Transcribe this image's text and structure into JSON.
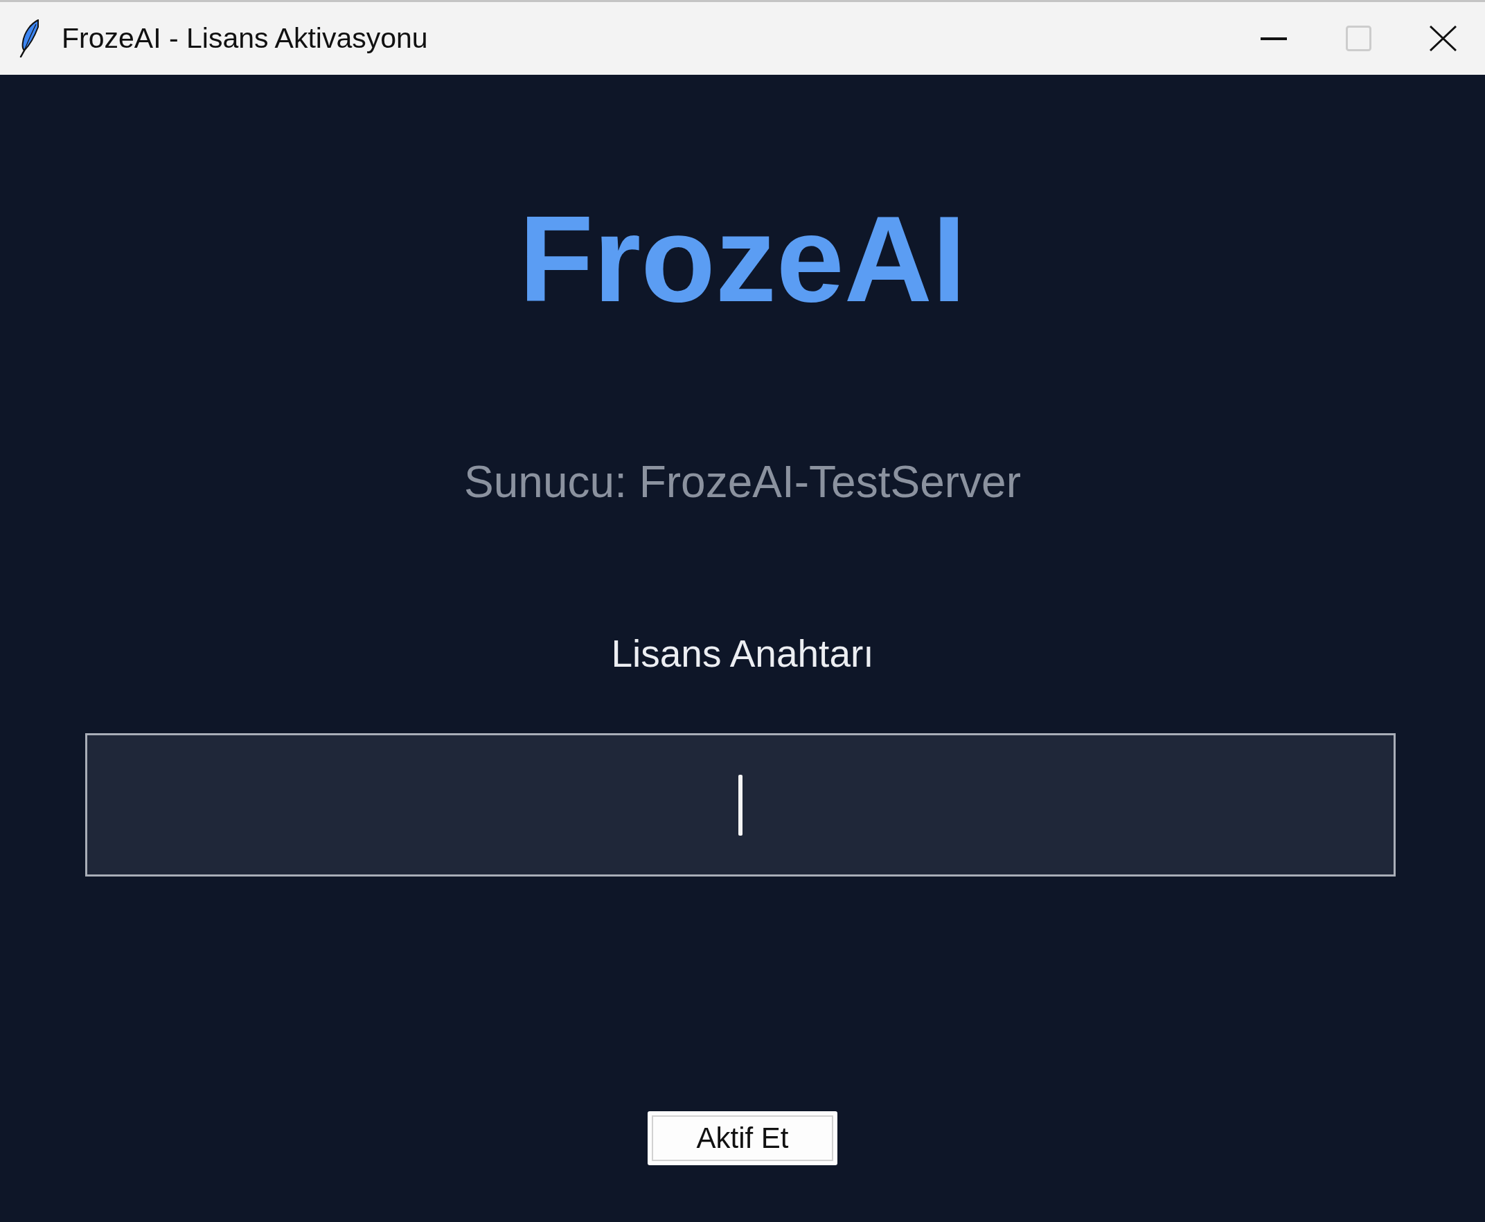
{
  "window": {
    "title": "FrozeAI - Lisans Aktivasyonu",
    "maximize_disabled": true
  },
  "heading": "FrozeAI",
  "server_label": "Sunucu: FrozeAI-TestServer",
  "license_field": {
    "label": "Lisans Anahtarı",
    "focused": true
  },
  "activate_button": {
    "label": "Aktif Et"
  }
}
